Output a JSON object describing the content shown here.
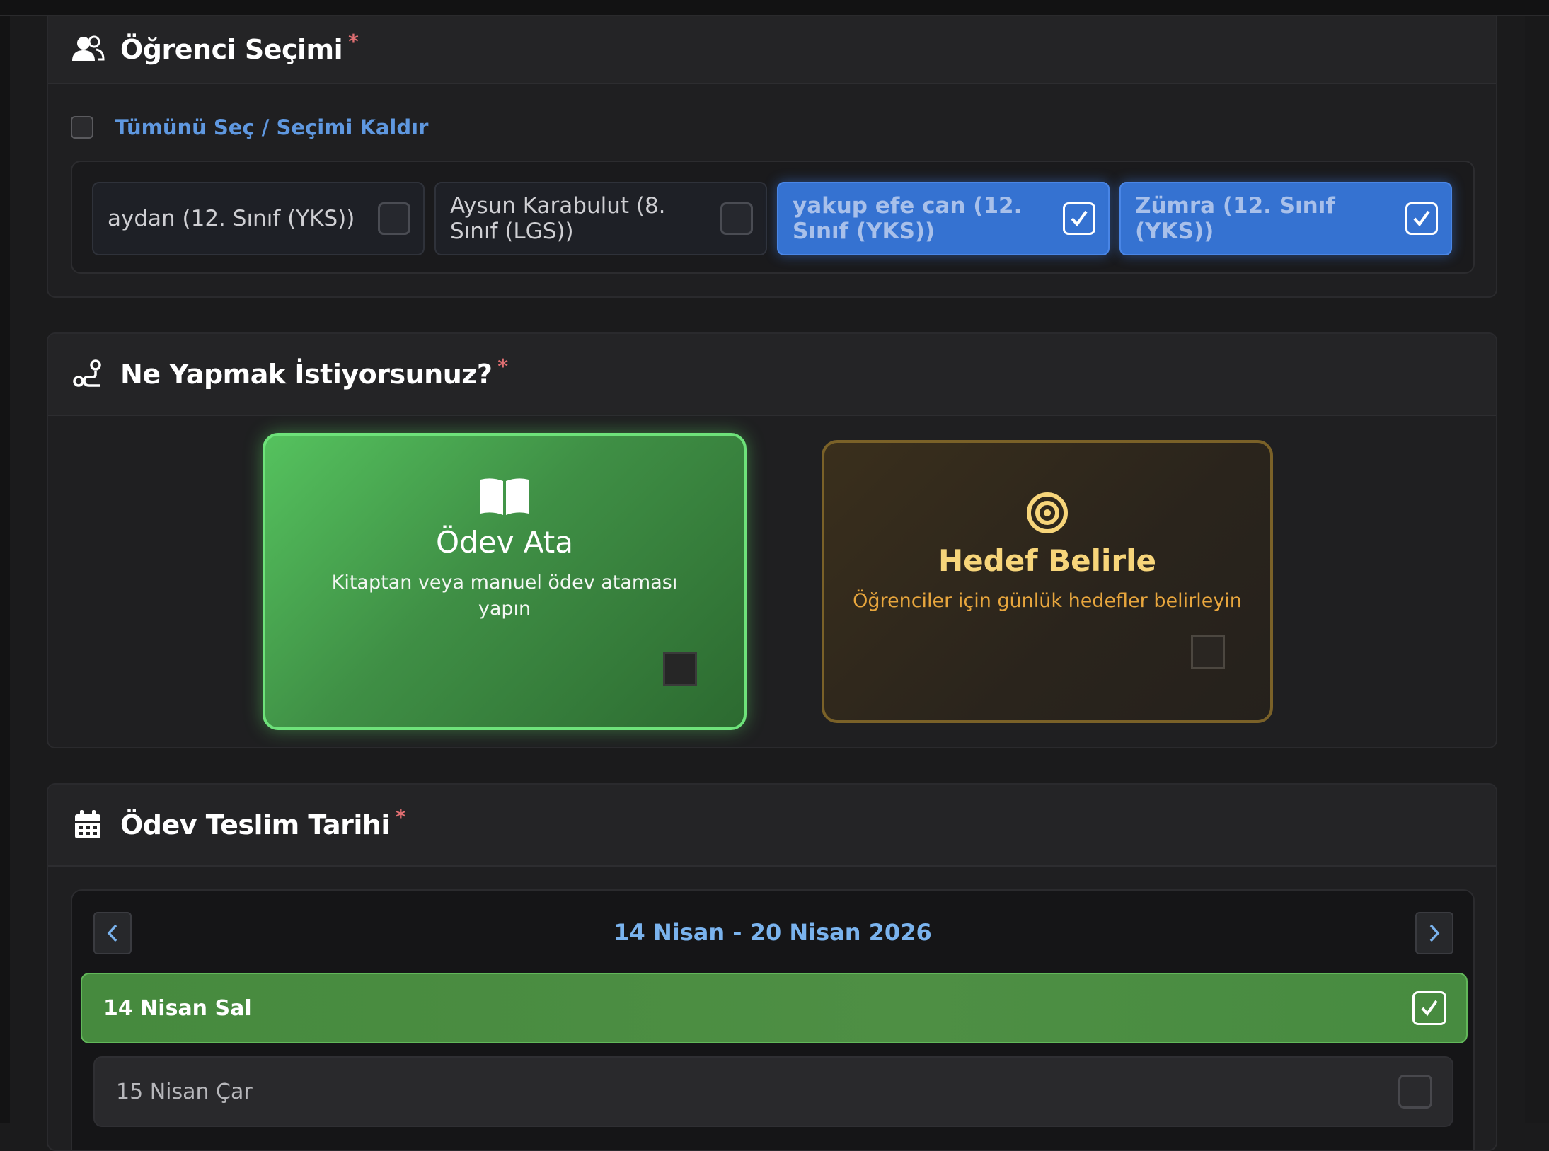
{
  "students_section": {
    "title": "Öğrenci Seçimi",
    "required_mark": "*",
    "select_all_label": "Tümünü Seç / Seçimi Kaldır",
    "students": [
      {
        "label": "aydan (12. Sınıf (YKS))",
        "selected": false
      },
      {
        "label": "Aysun Karabulut (8. Sınıf (LGS))",
        "selected": false
      },
      {
        "label": "yakup efe can (12. Sınıf (YKS))",
        "selected": true
      },
      {
        "label": "Zümra (12. Sınıf (YKS))",
        "selected": true
      }
    ]
  },
  "action_section": {
    "title": "Ne Yapmak İstiyorsunuz?",
    "required_mark": "*",
    "options": [
      {
        "title": "Ödev Ata",
        "description": "Kitaptan veya manuel ödev ataması yapın",
        "icon": "open-book-icon",
        "selected": true
      },
      {
        "title": "Hedef Belirle",
        "description": "Öğrenciler için günlük hedefler belirleyin",
        "icon": "target-icon",
        "selected": false
      }
    ]
  },
  "date_section": {
    "title": "Ödev Teslim Tarihi",
    "required_mark": "*",
    "week_range": "14 Nisan - 20 Nisan 2026",
    "days": [
      {
        "label": "14 Nisan Sal",
        "selected": true
      },
      {
        "label": "15 Nisan Çar",
        "selected": false
      }
    ]
  },
  "colors": {
    "accent_blue": "#3572d1",
    "accent_green": "#4e8f44",
    "accent_gold": "#f7d57a",
    "required_red": "#e06f72"
  }
}
